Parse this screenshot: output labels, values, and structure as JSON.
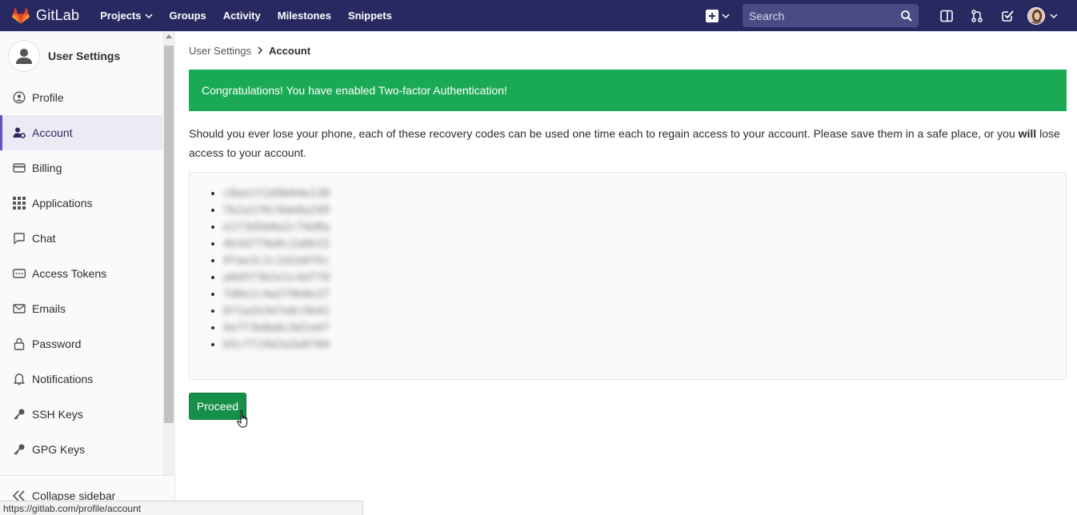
{
  "navbar": {
    "brand": "GitLab",
    "links": [
      {
        "label": "Projects",
        "dropdown": true
      },
      {
        "label": "Groups",
        "dropdown": false
      },
      {
        "label": "Activity",
        "dropdown": false
      },
      {
        "label": "Milestones",
        "dropdown": false
      },
      {
        "label": "Snippets",
        "dropdown": false
      }
    ],
    "search_placeholder": "Search",
    "bg_color": "#292961"
  },
  "sidebar": {
    "title": "User Settings",
    "items": [
      {
        "label": "Profile",
        "icon": "profile-icon"
      },
      {
        "label": "Account",
        "icon": "account-icon",
        "active": true
      },
      {
        "label": "Billing",
        "icon": "credit-card-icon"
      },
      {
        "label": "Applications",
        "icon": "applications-icon"
      },
      {
        "label": "Chat",
        "icon": "chat-icon"
      },
      {
        "label": "Access Tokens",
        "icon": "token-icon"
      },
      {
        "label": "Emails",
        "icon": "mail-icon"
      },
      {
        "label": "Password",
        "icon": "lock-icon"
      },
      {
        "label": "Notifications",
        "icon": "bell-icon"
      },
      {
        "label": "SSH Keys",
        "icon": "key-icon"
      },
      {
        "label": "GPG Keys",
        "icon": "key-icon"
      }
    ],
    "collapse_label": "Collapse sidebar"
  },
  "breadcrumb": {
    "parent": "User Settings",
    "current": "Account"
  },
  "flash": {
    "message": "Congratulations! You have enabled Two-factor Authentication!",
    "color": "#1aaa55"
  },
  "message": {
    "before": "Should you ever lose your phone, each of these recovery codes can be used one time each to regain access to your account. Please save them in a safe place, or you ",
    "bold": "will",
    "after": " lose access to your account."
  },
  "recovery_codes": [
    "c8ae1f2d9b04e130",
    "7b2a1f0c9de8a249",
    "e1f3d5b0a2c74d8a",
    "4b3d7f9e0c2a8b15",
    "9fae3c1c1d2e0f6c",
    "a0d5f3b2e1c4d7f0",
    "7d0e1c4a2f9b8e37",
    "0f1a2b3d7e8c9b41",
    "4e7f3b8a0c9d1e6f",
    "b5c7f19d2a3e8f04"
  ],
  "proceed_label": "Proceed",
  "status_url": "https://gitlab.com/profile/account"
}
